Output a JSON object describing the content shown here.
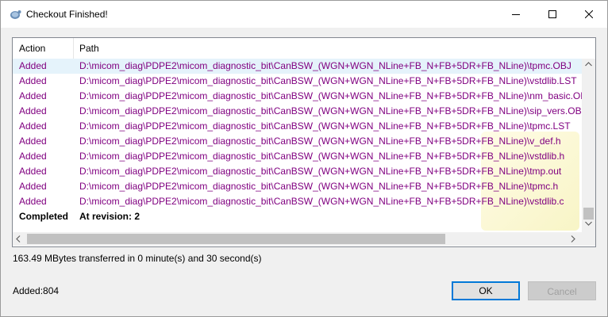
{
  "window": {
    "title": "Checkout Finished!",
    "icon": "tortoise-svn-icon"
  },
  "list": {
    "columns": {
      "action": "Action",
      "path": "Path"
    },
    "rows": [
      {
        "action": "Added",
        "path": "D:\\micom_diag\\PDPE2\\micom_diagnostic_bit\\CanBSW_(WGN+WGN_NLine+FB_N+FB+5DR+FB_NLine)\\tpmc.OBJ"
      },
      {
        "action": "Added",
        "path": "D:\\micom_diag\\PDPE2\\micom_diagnostic_bit\\CanBSW_(WGN+WGN_NLine+FB_N+FB+5DR+FB_NLine)\\vstdlib.LST"
      },
      {
        "action": "Added",
        "path": "D:\\micom_diag\\PDPE2\\micom_diagnostic_bit\\CanBSW_(WGN+WGN_NLine+FB_N+FB+5DR+FB_NLine)\\nm_basic.OBJ"
      },
      {
        "action": "Added",
        "path": "D:\\micom_diag\\PDPE2\\micom_diagnostic_bit\\CanBSW_(WGN+WGN_NLine+FB_N+FB+5DR+FB_NLine)\\sip_vers.OBJ"
      },
      {
        "action": "Added",
        "path": "D:\\micom_diag\\PDPE2\\micom_diagnostic_bit\\CanBSW_(WGN+WGN_NLine+FB_N+FB+5DR+FB_NLine)\\tpmc.LST"
      },
      {
        "action": "Added",
        "path": "D:\\micom_diag\\PDPE2\\micom_diagnostic_bit\\CanBSW_(WGN+WGN_NLine+FB_N+FB+5DR+FB_NLine)\\v_def.h"
      },
      {
        "action": "Added",
        "path": "D:\\micom_diag\\PDPE2\\micom_diagnostic_bit\\CanBSW_(WGN+WGN_NLine+FB_N+FB+5DR+FB_NLine)\\vstdlib.h"
      },
      {
        "action": "Added",
        "path": "D:\\micom_diag\\PDPE2\\micom_diagnostic_bit\\CanBSW_(WGN+WGN_NLine+FB_N+FB+5DR+FB_NLine)\\tmp.out"
      },
      {
        "action": "Added",
        "path": "D:\\micom_diag\\PDPE2\\micom_diagnostic_bit\\CanBSW_(WGN+WGN_NLine+FB_N+FB+5DR+FB_NLine)\\tpmc.h"
      },
      {
        "action": "Added",
        "path": "D:\\micom_diag\\PDPE2\\micom_diagnostic_bit\\CanBSW_(WGN+WGN_NLine+FB_N+FB+5DR+FB_NLine)\\vstdlib.c"
      }
    ],
    "completed": {
      "action": "Completed",
      "path": "At revision: 2"
    }
  },
  "status": {
    "transfer": "163.49 MBytes transferred in 0 minute(s) and 30 second(s)",
    "added": "Added:804"
  },
  "buttons": {
    "ok": "OK",
    "cancel": "Cancel"
  },
  "colors": {
    "added": "#800080",
    "selection": "#e5f3fb",
    "focus": "#0078d7"
  }
}
